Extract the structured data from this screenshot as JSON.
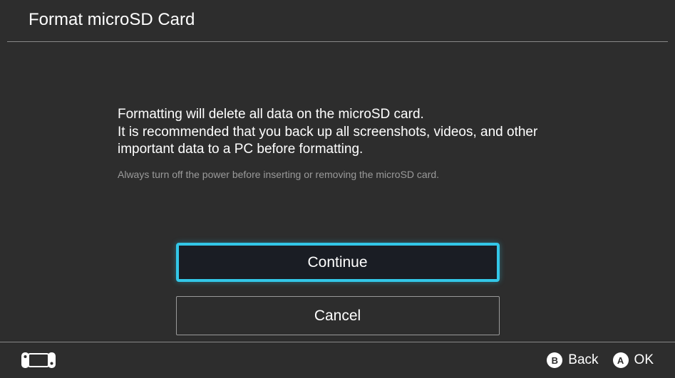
{
  "header": {
    "title": "Format microSD Card"
  },
  "content": {
    "primary_line1": "Formatting will delete all data on the microSD card.",
    "primary_line2": "It is recommended that you back up all screenshots, videos, and other important data to a PC before formatting.",
    "secondary": "Always turn off the power before inserting or removing the microSD card."
  },
  "buttons": {
    "continue": "Continue",
    "cancel": "Cancel"
  },
  "footer": {
    "b_glyph": "B",
    "b_label": "Back",
    "a_glyph": "A",
    "a_label": "OK"
  }
}
